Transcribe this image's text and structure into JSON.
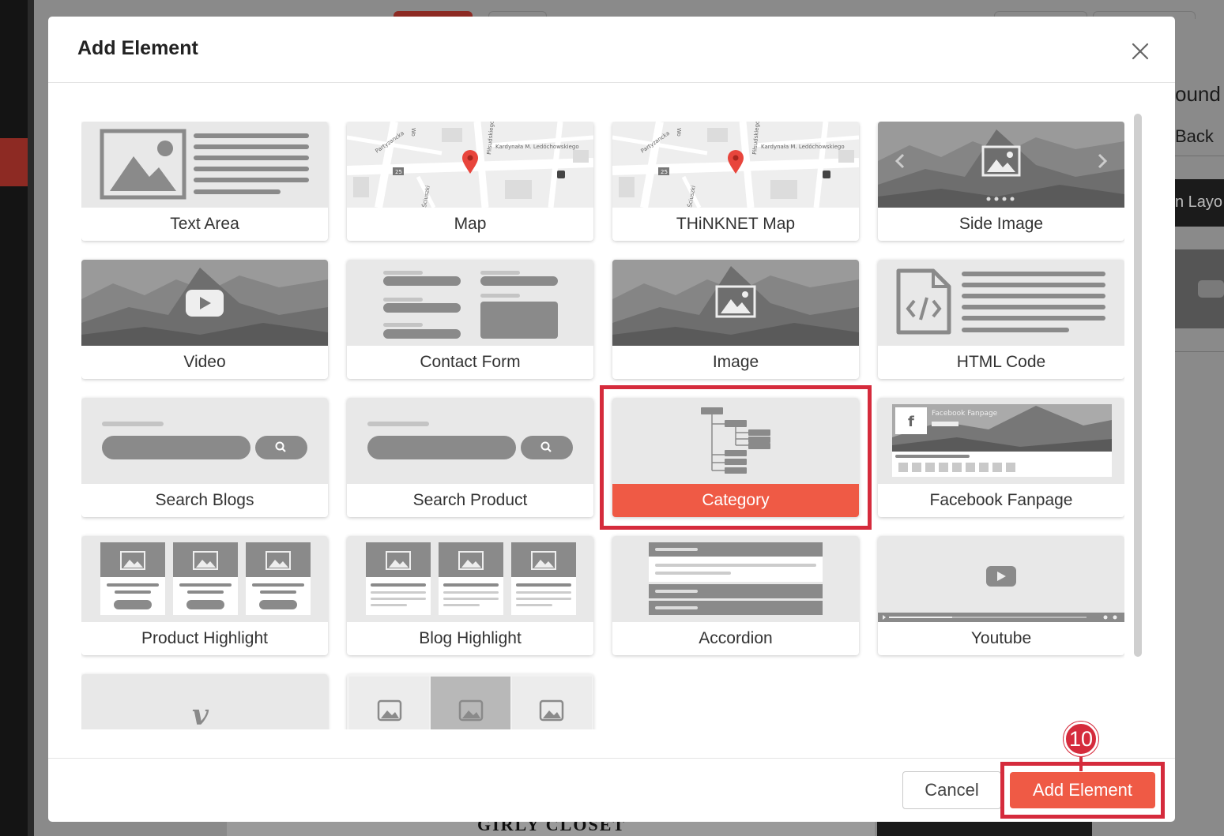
{
  "modal": {
    "title": "Add Element",
    "close_icon": "close-icon"
  },
  "background": {
    "right_texts": [
      "ound",
      "Back",
      "n Layo"
    ],
    "bottom_text": "GIRLY CLOSET"
  },
  "elements": [
    {
      "label": "Text Area",
      "icon": "text-area-thumbnail"
    },
    {
      "label": "Map",
      "icon": "map-thumbnail"
    },
    {
      "label": "THiNKNET Map",
      "icon": "map-thumbnail"
    },
    {
      "label": "Side Image",
      "icon": "slider-thumbnail"
    },
    {
      "label": "Video",
      "icon": "video-thumbnail"
    },
    {
      "label": "Contact Form",
      "icon": "form-thumbnail"
    },
    {
      "label": "Image",
      "icon": "image-thumbnail"
    },
    {
      "label": "HTML Code",
      "icon": "code-thumbnail"
    },
    {
      "label": "Search Blogs",
      "icon": "search-thumbnail"
    },
    {
      "label": "Search Product",
      "icon": "search-thumbnail"
    },
    {
      "label": "Category",
      "icon": "tree-thumbnail",
      "selected": true
    },
    {
      "label": "Facebook Fanpage",
      "icon": "facebook-thumbnail"
    },
    {
      "label": "Product Highlight",
      "icon": "product-grid-thumbnail"
    },
    {
      "label": "Blog Highlight",
      "icon": "blog-grid-thumbnail"
    },
    {
      "label": "Accordion",
      "icon": "accordion-thumbnail"
    },
    {
      "label": "Youtube",
      "icon": "youtube-thumbnail"
    },
    {
      "label": "",
      "icon": "vimeo-thumbnail"
    },
    {
      "label": "",
      "icon": "gallery-thumbnail"
    }
  ],
  "map_labels": {
    "street_1": "Partyzancka",
    "street_2": "Kardynała M. Ledóchowskiego",
    "street_3": "Piłsudskiego",
    "street_4": "Wo",
    "street_5": "Ściuszki",
    "badge": "25"
  },
  "facebook_caption": "Facebook Fanpage",
  "footer": {
    "cancel_label": "Cancel",
    "add_label": "Add Element"
  },
  "step_badge": "10",
  "colors": {
    "accent": "#ef5a45",
    "highlight": "#d52b3c",
    "thumb_bg": "#e8e8e8",
    "thumb_dark": "#8a8a8a"
  }
}
